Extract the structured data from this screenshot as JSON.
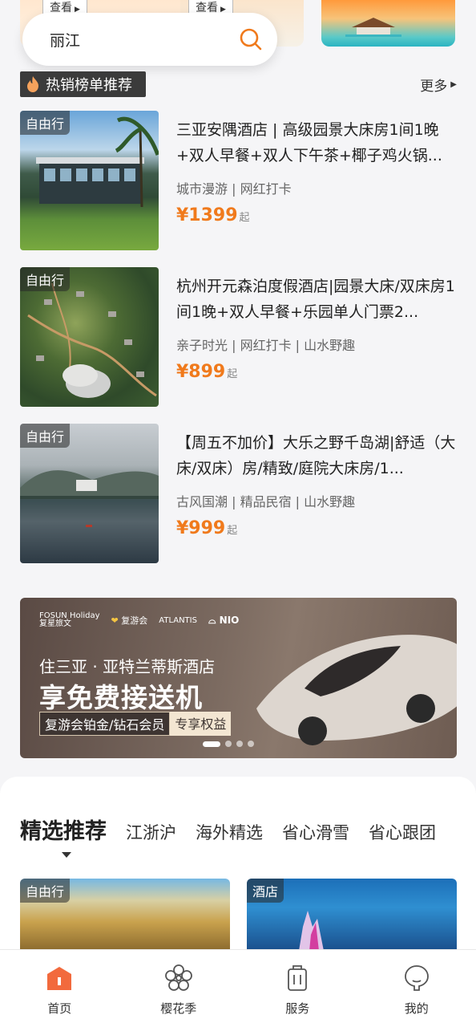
{
  "top_peek": {
    "view_label_1": "查看",
    "view_label_2": "查看"
  },
  "search": {
    "value": "丽江"
  },
  "hot_section": {
    "title": "热销榜单推荐",
    "more": "更多"
  },
  "products": [
    {
      "badge": "自由行",
      "title": "三亚安隅酒店 | 高级园景大床房1间1晚+双人早餐+双人下午茶+椰子鸡火锅...",
      "tags": "城市漫游 | 网红打卡",
      "price": "¥1399",
      "price_suffix": "起"
    },
    {
      "badge": "自由行",
      "title": "杭州开元森泊度假酒店|园景大床/双床房1间1晚+双人早餐+乐园单人门票2...",
      "tags": "亲子时光 | 网红打卡 | 山水野趣",
      "price": "¥899",
      "price_suffix": "起"
    },
    {
      "badge": "自由行",
      "title": "【周五不加价】大乐之野千岛湖|舒适（大床/双床）房/精致/庭院大床房/1...",
      "tags": "古风国潮 | 精品民宿 | 山水野趣",
      "price": "¥999",
      "price_suffix": "起"
    }
  ],
  "banner": {
    "brand_1a": "FOSUN Holiday",
    "brand_1b": "复星旅文",
    "brand_2": "复游会",
    "brand_3a": "ATLANTIS",
    "brand_4": "NIO",
    "line1": "住三亚 · 亚特兰蒂斯酒店",
    "line2": "享免费接送机",
    "line3_a": "复游会铂金/钻石会员",
    "line3_b": "专享权益",
    "slides_total": 4,
    "slide_active": 1
  },
  "curated": {
    "title": "精选推荐",
    "tabs": [
      "江浙沪",
      "海外精选",
      "省心滑雪",
      "省心跟团"
    ],
    "cards": [
      {
        "badge": "自由行"
      },
      {
        "badge": "酒店"
      }
    ]
  },
  "bottom_nav": [
    {
      "label": "首页",
      "icon": "home-icon",
      "active": true
    },
    {
      "label": "樱花季",
      "icon": "sakura-icon",
      "active": false
    },
    {
      "label": "服务",
      "icon": "luggage-icon",
      "active": false
    },
    {
      "label": "我的",
      "icon": "profile-icon",
      "active": false
    }
  ],
  "colors": {
    "accent": "#f07a1c",
    "tag_bg": "#3b3b3b"
  }
}
